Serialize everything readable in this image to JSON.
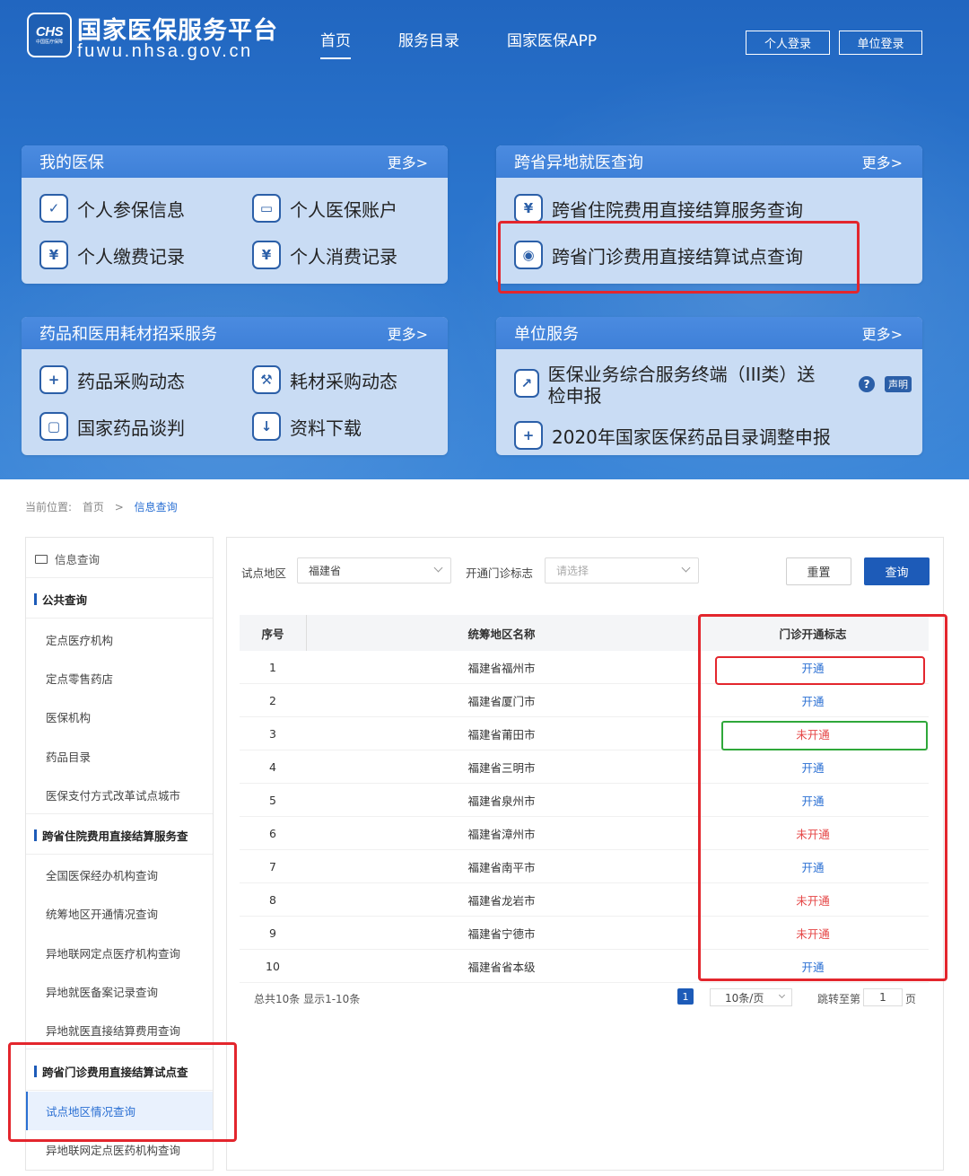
{
  "header": {
    "logo_text": "CHS",
    "logo_small": "中国医疗保障",
    "title": "国家医保服务平台",
    "domain": "fuwu.nhsa.gov.cn",
    "nav": [
      {
        "label": "首页",
        "active": true
      },
      {
        "label": "服务目录",
        "active": false
      },
      {
        "label": "国家医保APP",
        "active": false
      }
    ],
    "login_personal": "个人登录",
    "login_unit": "单位登录"
  },
  "cards": {
    "my_insurance": {
      "title": "我的医保",
      "more": "更多>",
      "items": [
        "个人参保信息",
        "个人医保账户",
        "个人缴费记录",
        "个人消费记录"
      ]
    },
    "cross_province": {
      "title": "跨省异地就医查询",
      "more": "更多>",
      "items": [
        "跨省住院费用直接结算服务查询",
        "跨省门诊费用直接结算试点查询"
      ]
    },
    "procurement": {
      "title": "药品和医用耗材招采服务",
      "more": "更多>",
      "items": [
        "药品采购动态",
        "耗材采购动态",
        "国家药品谈判",
        "资料下载"
      ]
    },
    "unit_service": {
      "title": "单位服务",
      "more": "更多>",
      "items": [
        "医保业务综合服务终端（III类）送检申报",
        "2020年国家医保药品目录调整申报"
      ],
      "help": "?",
      "statement": "声明"
    }
  },
  "breadcrumb": {
    "label": "当前位置:",
    "home": "首页",
    "sep": ">",
    "current": "信息查询"
  },
  "sidebar": {
    "top": "信息查询",
    "groups": [
      {
        "title": "公共查询",
        "items": [
          "定点医疗机构",
          "定点零售药店",
          "医保机构",
          "药品目录",
          "医保支付方式改革试点城市"
        ]
      },
      {
        "title": "跨省住院费用直接结算服务查",
        "items": [
          "全国医保经办机构查询",
          "统筹地区开通情况查询",
          "异地联网定点医疗机构查询",
          "异地就医备案记录查询",
          "异地就医直接结算费用查询"
        ]
      },
      {
        "title": "跨省门诊费用直接结算试点查",
        "items": [
          "试点地区情况查询",
          "异地联网定点医药机构查询"
        ]
      }
    ]
  },
  "filters": {
    "region_label": "试点地区",
    "region_value": "福建省",
    "status_label": "开通门诊标志",
    "status_placeholder": "请选择",
    "reset": "重置",
    "query": "查询"
  },
  "table": {
    "headers": [
      "序号",
      "统筹地区名称",
      "门诊开通标志"
    ],
    "rows": [
      {
        "no": "1",
        "name": "福建省福州市",
        "status": "开通",
        "open": true
      },
      {
        "no": "2",
        "name": "福建省厦门市",
        "status": "开通",
        "open": true
      },
      {
        "no": "3",
        "name": "福建省莆田市",
        "status": "未开通",
        "open": false
      },
      {
        "no": "4",
        "name": "福建省三明市",
        "status": "开通",
        "open": true
      },
      {
        "no": "5",
        "name": "福建省泉州市",
        "status": "开通",
        "open": true
      },
      {
        "no": "6",
        "name": "福建省漳州市",
        "status": "未开通",
        "open": false
      },
      {
        "no": "7",
        "name": "福建省南平市",
        "status": "开通",
        "open": true
      },
      {
        "no": "8",
        "name": "福建省龙岩市",
        "status": "未开通",
        "open": false
      },
      {
        "no": "9",
        "name": "福建省宁德市",
        "status": "未开通",
        "open": false
      },
      {
        "no": "10",
        "name": "福建省省本级",
        "status": "开通",
        "open": true
      }
    ]
  },
  "pagination": {
    "total": "总共10条 显示1-10条",
    "current_page": "1",
    "page_size": "10条/页",
    "jump_label": "跳转至第",
    "jump_value": "1",
    "jump_unit": "页"
  },
  "colors": {
    "brand_blue": "#1d5bb8",
    "open": "#2a6fd3",
    "closed": "#e54646",
    "highlight_red": "#e3262d",
    "highlight_green": "#2fa83a"
  }
}
